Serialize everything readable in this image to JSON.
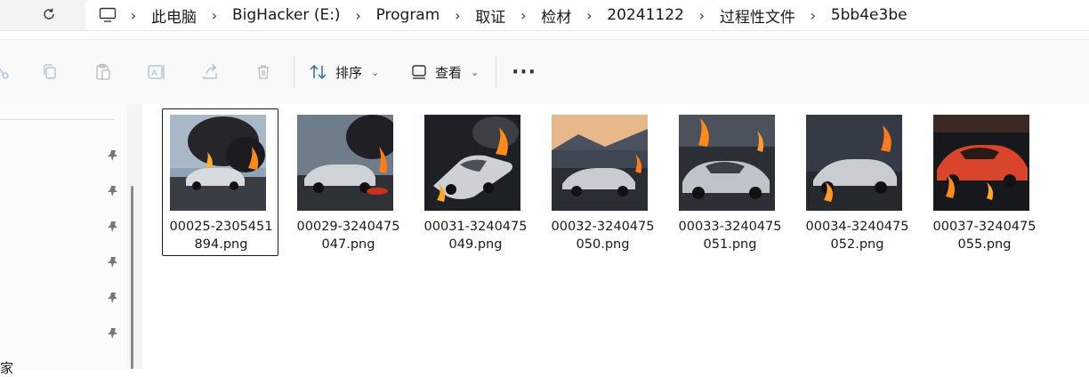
{
  "breadcrumb": {
    "items": [
      "此电脑",
      "BigHacker (E:)",
      "Program",
      "取证",
      "检材",
      "20241122",
      "过程性文件",
      "5bb4e3be"
    ]
  },
  "toolbar": {
    "sort_label": "排序",
    "view_label": "查看",
    "more_label": "···"
  },
  "navpane": {
    "cut_text": "家"
  },
  "files": [
    {
      "name": "00025-2305451894.png",
      "line1": "00025-2305451",
      "line2": "894.png"
    },
    {
      "name": "00029-3240475047.png",
      "line1": "00029-3240475",
      "line2": "047.png"
    },
    {
      "name": "00031-3240475049.png",
      "line1": "00031-3240475",
      "line2": "049.png"
    },
    {
      "name": "00032-3240475050.png",
      "line1": "00032-3240475",
      "line2": "050.png"
    },
    {
      "name": "00033-3240475051.png",
      "line1": "00033-3240475",
      "line2": "051.png"
    },
    {
      "name": "00034-3240475052.png",
      "line1": "00034-3240475",
      "line2": "052.png"
    },
    {
      "name": "00037-3240475055.png",
      "line1": "00037-3240475",
      "line2": "055.png"
    }
  ],
  "colors": {
    "accent_icon": "#8fb4d8",
    "fire": "#ff7a1a",
    "smoke": "#2a2a2e",
    "car_silver": "#c8cbd0",
    "car_red": "#d9452a"
  }
}
